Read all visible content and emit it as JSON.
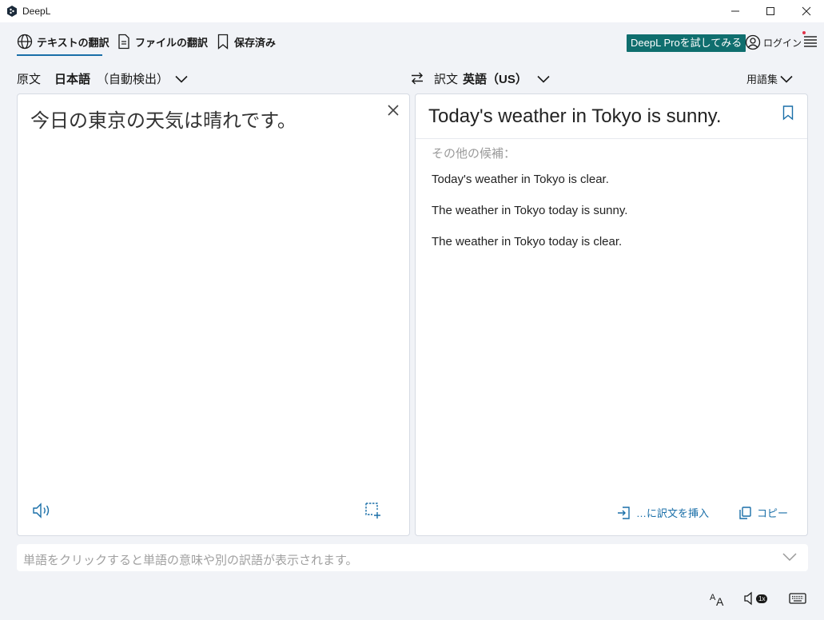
{
  "window": {
    "title": "DeepL"
  },
  "nav": {
    "tabs": [
      {
        "label": "テキストの翻訳",
        "icon": "globe-icon",
        "active": true
      },
      {
        "label": "ファイルの翻訳",
        "icon": "document-icon",
        "active": false
      },
      {
        "label": "保存済み",
        "icon": "bookmark-icon",
        "active": false
      }
    ],
    "pro_button": "DeepL Proを試してみる",
    "login": "ログイン"
  },
  "languages": {
    "source_label": "原文",
    "source_lang": "日本語",
    "source_detect": "（自動検出）",
    "target_label": "訳文",
    "target_lang": "英語（US）",
    "glossary": "用語集"
  },
  "source": {
    "text": "今日の東京の天気は晴れです。"
  },
  "target": {
    "translation": "Today's weather in Tokyo is sunny.",
    "alternatives_label": "その他の候補：",
    "alternatives": [
      "Today's weather in Tokyo is clear.",
      "The weather in Tokyo today is sunny.",
      "The weather in Tokyo today is clear."
    ],
    "insert_label": "…に訳文を挿入",
    "copy_label": "コピー"
  },
  "dictionary": {
    "hint": "単語をクリックすると単語の意味や別の訳語が表示されます。"
  },
  "footer": {
    "speed_badge": "1x"
  },
  "colors": {
    "accent": "#1a6fa8",
    "pro_button_bg": "#0f6e6e",
    "background": "#f1f3f7"
  }
}
